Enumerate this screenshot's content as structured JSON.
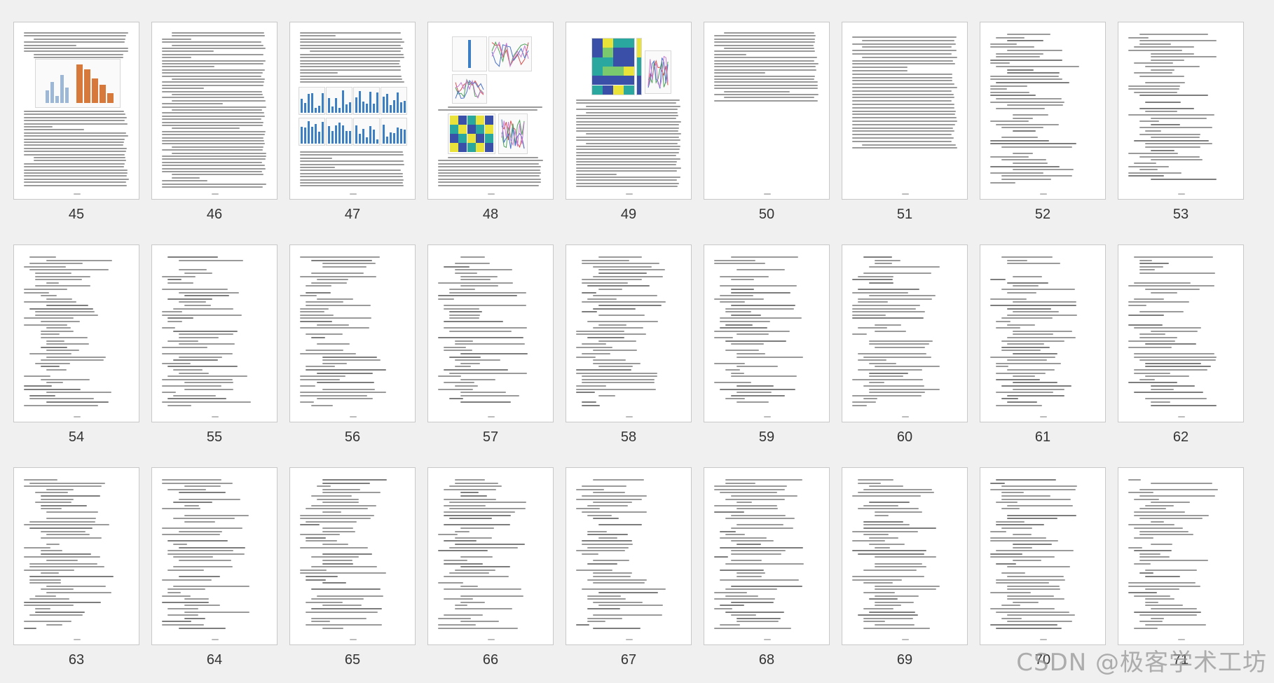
{
  "pages": [
    {
      "number": "45",
      "layout": "fig-bars-top"
    },
    {
      "number": "46",
      "layout": "text"
    },
    {
      "number": "47",
      "layout": "fig-blue-bars"
    },
    {
      "number": "48",
      "layout": "fig-line-charts"
    },
    {
      "number": "49",
      "layout": "fig-heatmap"
    },
    {
      "number": "50",
      "layout": "text-short"
    },
    {
      "number": "51",
      "layout": "references"
    },
    {
      "number": "52",
      "layout": "code"
    },
    {
      "number": "53",
      "layout": "code"
    },
    {
      "number": "54",
      "layout": "code"
    },
    {
      "number": "55",
      "layout": "code"
    },
    {
      "number": "56",
      "layout": "code"
    },
    {
      "number": "57",
      "layout": "code"
    },
    {
      "number": "58",
      "layout": "code"
    },
    {
      "number": "59",
      "layout": "code"
    },
    {
      "number": "60",
      "layout": "code"
    },
    {
      "number": "61",
      "layout": "code"
    },
    {
      "number": "62",
      "layout": "code"
    },
    {
      "number": "63",
      "layout": "code"
    },
    {
      "number": "64",
      "layout": "code"
    },
    {
      "number": "65",
      "layout": "code"
    },
    {
      "number": "66",
      "layout": "code"
    },
    {
      "number": "67",
      "layout": "code"
    },
    {
      "number": "68",
      "layout": "code"
    },
    {
      "number": "69",
      "layout": "code"
    },
    {
      "number": "70",
      "layout": "code"
    },
    {
      "number": "71",
      "layout": "code"
    }
  ],
  "watermark": "CSDN @极客学术工坊",
  "colors": {
    "background": "#f0f0f0",
    "page": "#ffffff",
    "text_line": "#9a9a9a",
    "bar_blue": "#3d7fc4",
    "bar_orange": "#d7793a",
    "heat_yellow": "#e8e23a",
    "heat_teal": "#2aa8a0",
    "heat_blue": "#3a4fa8"
  }
}
